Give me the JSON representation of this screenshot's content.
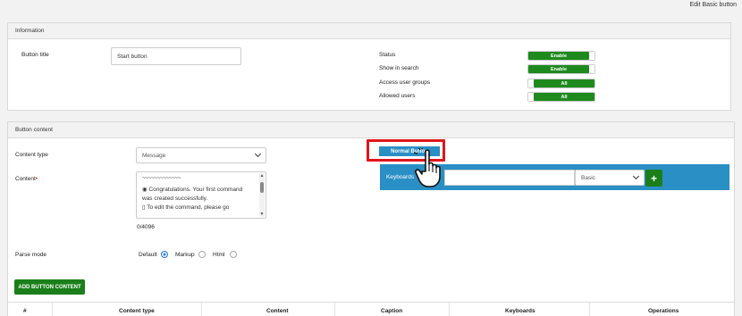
{
  "header": {
    "page_title": "Edit Basic button"
  },
  "information": {
    "section_title": "Information",
    "button_title_label": "Button title",
    "button_title_value": "Start button",
    "status_label": "Status",
    "status_value": "Enable",
    "show_in_search_label": "Show in search",
    "show_in_search_value": "Enable",
    "access_groups_label": "Access user groups",
    "access_groups_value": "All",
    "allowed_users_label": "Allowed users",
    "allowed_users_value": "All"
  },
  "content": {
    "section_title": "Button content",
    "content_type_label": "Content type",
    "content_type_value": "Message",
    "content_label": "Content",
    "content_text_line1": "~~~~~~~~~~~~~",
    "content_text_line2": "Congratulations. Your first command",
    "content_text_line3": "was created successfully.",
    "content_text_line4": "To edit the command, please go",
    "content_counter": "0/4096",
    "parse_mode_label": "Parse mode",
    "parse_default": "Default",
    "parse_markup": "Markup",
    "parse_html": "Html",
    "add_button": "ADD BUTTON CONTENT",
    "normal_button_tab": "Normal Button",
    "keyboards_label": "Keyboards",
    "keyboard_input_value": "",
    "keyboard_type_value": "Basic",
    "add_keyboard_symbol": "+"
  },
  "table": {
    "columns": [
      "#",
      "Content type",
      "Content",
      "Caption",
      "Keyboards",
      "Operations"
    ]
  },
  "colors": {
    "accent_green": "#1a7f1a",
    "keyboard_blue": "#2a8fc4",
    "highlight_red": "#e0161b"
  }
}
